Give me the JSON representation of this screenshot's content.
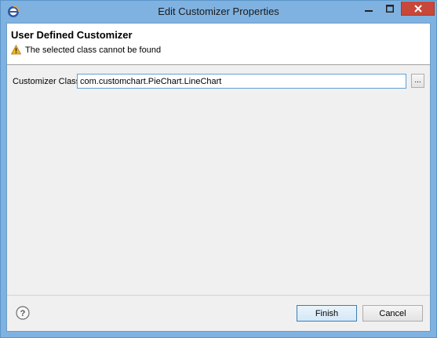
{
  "window": {
    "title": "Edit Customizer Properties"
  },
  "header": {
    "title": "User Defined Customizer",
    "message": "The selected class cannot be found"
  },
  "form": {
    "customizer_class_label": "Customizer Class",
    "customizer_class_value": "com.customchart.PieChart.LineChart",
    "browse_label": "..."
  },
  "footer": {
    "finish_label": "Finish",
    "cancel_label": "Cancel"
  },
  "colors": {
    "titlebar": "#7fb2e0",
    "close_button": "#c7483b",
    "warning": "#f0b429",
    "input_focus_border": "#5da2d5"
  },
  "icons": {
    "app": "eclipse-icon",
    "warning": "warning-icon",
    "help": "help-icon"
  }
}
